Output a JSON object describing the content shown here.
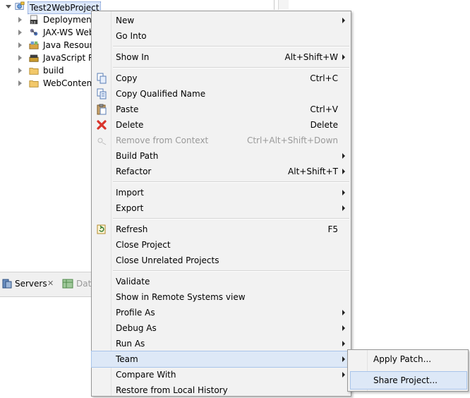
{
  "explorer": {
    "root": "Test2WebProject",
    "items": [
      {
        "label": "Deployment",
        "icon": "deployment-descriptor-icon"
      },
      {
        "label": "JAX-WS Web",
        "icon": "jaxws-icon"
      },
      {
        "label": "Java Resourc",
        "icon": "java-resources-icon"
      },
      {
        "label": "JavaScript Re",
        "icon": "javascript-resources-icon"
      },
      {
        "label": "build",
        "icon": "folder-icon"
      },
      {
        "label": "WebContent",
        "icon": "folder-icon"
      }
    ]
  },
  "bottom_panel": {
    "tabs": [
      {
        "label": "Servers",
        "icon": "servers-icon",
        "close": "✕"
      },
      {
        "label": "Dat",
        "icon": "data-source-icon"
      }
    ]
  },
  "context_menu": {
    "items": [
      {
        "label": "New",
        "shortcut": "",
        "submenu": true
      },
      {
        "label": "Go Into",
        "shortcut": ""
      },
      {
        "label": "Show In",
        "shortcut": "Alt+Shift+W",
        "submenu": true
      },
      {
        "label": "Copy",
        "shortcut": "Ctrl+C",
        "icon": "copy-icon"
      },
      {
        "label": "Copy Qualified Name",
        "shortcut": "",
        "icon": "copy-qualified-icon"
      },
      {
        "label": "Paste",
        "shortcut": "Ctrl+V",
        "icon": "paste-icon"
      },
      {
        "label": "Delete",
        "shortcut": "Delete",
        "icon": "delete-icon"
      },
      {
        "label": "Remove from Context",
        "shortcut": "Ctrl+Alt+Shift+Down",
        "icon": "remove-context-icon",
        "disabled": true
      },
      {
        "label": "Build Path",
        "shortcut": "",
        "submenu": true
      },
      {
        "label": "Refactor",
        "shortcut": "Alt+Shift+T",
        "submenu": true
      },
      {
        "label": "Import",
        "shortcut": "",
        "submenu": true
      },
      {
        "label": "Export",
        "shortcut": "",
        "submenu": true
      },
      {
        "label": "Refresh",
        "shortcut": "F5",
        "icon": "refresh-icon"
      },
      {
        "label": "Close Project",
        "shortcut": ""
      },
      {
        "label": "Close Unrelated Projects",
        "shortcut": ""
      },
      {
        "label": "Validate",
        "shortcut": ""
      },
      {
        "label": "Show in Remote Systems view",
        "shortcut": ""
      },
      {
        "label": "Profile As",
        "shortcut": "",
        "submenu": true
      },
      {
        "label": "Debug As",
        "shortcut": "",
        "submenu": true
      },
      {
        "label": "Run As",
        "shortcut": "",
        "submenu": true
      },
      {
        "label": "Team",
        "shortcut": "",
        "submenu": true,
        "highlighted": true
      },
      {
        "label": "Compare With",
        "shortcut": "",
        "submenu": true
      },
      {
        "label": "Restore from Local History",
        "shortcut": ""
      }
    ]
  },
  "team_submenu": {
    "items": [
      {
        "label": "Apply Patch..."
      },
      {
        "label": "Share Project...",
        "highlighted": true
      }
    ]
  },
  "colors": {
    "menu_bg": "#f2f2f2",
    "highlight_bg": "#dde8f7",
    "highlight_border": "#a8c4ea",
    "disabled_text": "#9a9a9a",
    "delete_icon": "#d9342b"
  }
}
